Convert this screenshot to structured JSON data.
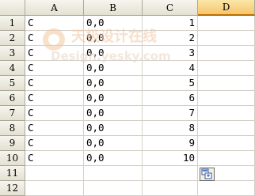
{
  "columns": [
    "A",
    "B",
    "C",
    "D"
  ],
  "selected_column": "D",
  "rows": [
    {
      "num": "1",
      "a": "C",
      "b": "0,0",
      "c": "1"
    },
    {
      "num": "2",
      "a": "C",
      "b": "0,0",
      "c": "2"
    },
    {
      "num": "3",
      "a": "C",
      "b": "0,0",
      "c": "3"
    },
    {
      "num": "4",
      "a": "C",
      "b": "0,0",
      "c": "4"
    },
    {
      "num": "5",
      "a": "C",
      "b": "0,0",
      "c": "5"
    },
    {
      "num": "6",
      "a": "C",
      "b": "0,0",
      "c": "6"
    },
    {
      "num": "7",
      "a": "C",
      "b": "0,0",
      "c": "7"
    },
    {
      "num": "8",
      "a": "C",
      "b": "0,0",
      "c": "8"
    },
    {
      "num": "9",
      "a": "C",
      "b": "0,0",
      "c": "9"
    },
    {
      "num": "10",
      "a": "C",
      "b": "0,0",
      "c": "10"
    },
    {
      "num": "11",
      "a": "",
      "b": "",
      "c": ""
    },
    {
      "num": "12",
      "a": "",
      "b": "",
      "c": ""
    }
  ],
  "watermark": {
    "line1": "天极设计在线",
    "line2": "Design.yesky.com"
  },
  "paste_options_icon": "paste-options-icon"
}
